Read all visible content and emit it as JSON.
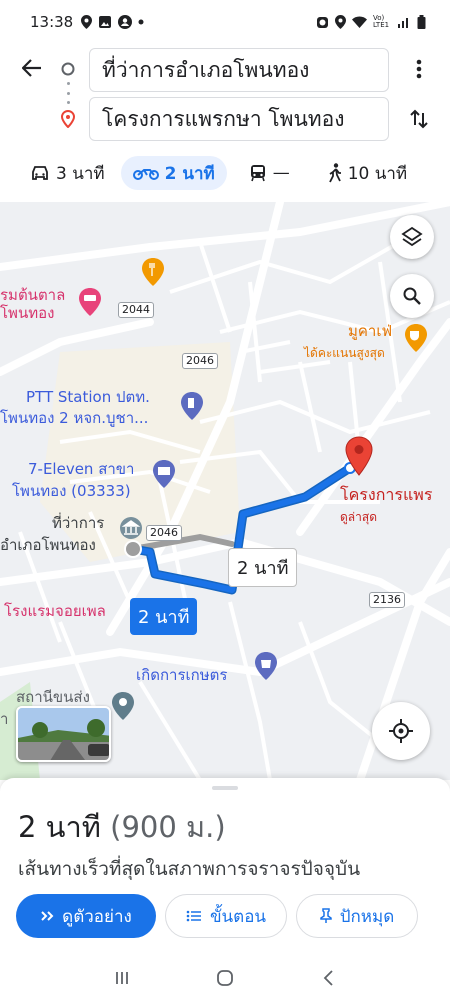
{
  "status_bar": {
    "time": "13:38",
    "left_icons": [
      "location-icon",
      "image-icon",
      "account-icon",
      "dot-icon"
    ],
    "right_icons": [
      "alarm-icon",
      "location-icon",
      "wifi-icon",
      "volte-icon",
      "signal-icon",
      "battery-icon"
    ],
    "network_label": "Vo) LTE1"
  },
  "directions": {
    "origin": "ที่ว่าการอำเภอโพนทอง",
    "destination": "โครงการแพรกษา โพนทอง",
    "modes": [
      {
        "icon": "car-icon",
        "label": "3 นาที",
        "active": false
      },
      {
        "icon": "motorcycle-icon",
        "label": "2 นาที",
        "active": true
      },
      {
        "icon": "transit-icon",
        "label": "—",
        "active": false
      },
      {
        "icon": "walk-icon",
        "label": "10 นาที",
        "active": false
      }
    ]
  },
  "map": {
    "labels": {
      "hotel_top": "รมต้นตาล",
      "hotel_top_2": "โพนทอง",
      "ptt_1": "PTT Station ปตท.",
      "ptt_2": "โพนทอง 2 หจก.บูชา...",
      "seven_1": "7-Eleven สาขา",
      "seven_2": "โพนทอง (03333)",
      "office_1": "ที่ว่าการ",
      "office_2": "อำเภอโพนทอง",
      "cafe": "มูคาเฟ่",
      "cafe_note": "ได้คะแนนสูงสุด",
      "dest_name": "โครงการแพร",
      "dest_note": "ดูล่าสุด",
      "hotel_bottom": "โรงแรมจอยเพล",
      "farm": "เกิดการเกษตร",
      "station": "สถานีขนส่ง",
      "station_left": "า"
    },
    "roads": {
      "r2044": "2044",
      "r2046_a": "2046",
      "r2046_b": "2046",
      "r2136": "2136"
    },
    "chips": {
      "alt_route": "2 นาที",
      "selected_route": "2 นาที"
    },
    "colors": {
      "route": "#1a73e8",
      "alt_route": "#9e9e9e",
      "dest_pin": "#ea4335"
    }
  },
  "sheet": {
    "duration": "2 นาที",
    "distance": "(900 ม.)",
    "subtitle": "เส้นทางเร็วที่สุดในสภาพการจราจรปัจจุบัน",
    "preview_button": "ดูตัวอย่าง",
    "steps_button": "ขั้นตอน",
    "pin_button": "ปักหมุด"
  },
  "navbar": {
    "icons": [
      "recents-icon",
      "home-icon",
      "back-icon"
    ]
  }
}
